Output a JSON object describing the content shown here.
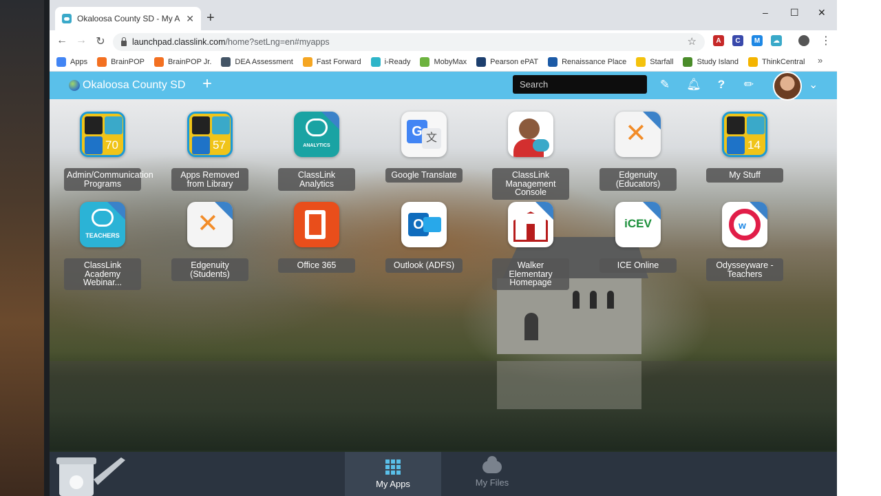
{
  "browser": {
    "tab_title": "Okaloosa County SD - My Apps",
    "new_tab": "+",
    "url_host": "launchpad.classlink.com",
    "url_path": "/home?setLng=en#myapps",
    "window_controls": {
      "minimize": "–",
      "maximize": "☐",
      "close": "✕"
    },
    "bookmarks": [
      {
        "label": "Apps",
        "color": "#4285f4"
      },
      {
        "label": "BrainPOP",
        "color": "#f37021"
      },
      {
        "label": "BrainPOP Jr.",
        "color": "#f37021"
      },
      {
        "label": "DEA Assessment",
        "color": "#445566"
      },
      {
        "label": "Fast Forward",
        "color": "#f5a623"
      },
      {
        "label": "i-Ready",
        "color": "#2eb5c9"
      },
      {
        "label": "MobyMax",
        "color": "#6db33f"
      },
      {
        "label": "Pearson ePAT",
        "color": "#1d3f6e"
      },
      {
        "label": "Renaissance Place",
        "color": "#1c5aa6"
      },
      {
        "label": "Starfall",
        "color": "#f4c20d"
      },
      {
        "label": "Study Island",
        "color": "#4a8c2a"
      },
      {
        "label": "ThinkCentral",
        "color": "#f4b400"
      }
    ],
    "bookmarks_more": "»",
    "extensions": [
      {
        "letter": "A",
        "color": "#c62828"
      },
      {
        "letter": "C",
        "color": "#3949ab"
      },
      {
        "letter": "M",
        "color": "#1e88e5"
      },
      {
        "letter": "☁",
        "color": "#3aa9c9"
      }
    ]
  },
  "header": {
    "org_name": "Okaloosa County SD",
    "add": "+",
    "search_placeholder": "Search",
    "accent": "#5ac0ea"
  },
  "apps": [
    {
      "label": "Admin/Communication Programs",
      "icon": "folder-icon",
      "badge": "70"
    },
    {
      "label": "Apps Removed from Library",
      "icon": "folder-icon",
      "badge": "57"
    },
    {
      "label": "ClassLink Analytics",
      "icon": "classlink-analytics-icon",
      "sub": "ANALYTICS"
    },
    {
      "label": "Google Translate",
      "icon": "google-translate-icon"
    },
    {
      "label": "ClassLink Management Console",
      "icon": "management-console-icon"
    },
    {
      "label": "Edgenuity (Educators)",
      "icon": "edgenuity-icon"
    },
    {
      "label": "My Stuff",
      "icon": "folder-icon",
      "badge": "14"
    },
    {
      "label": "ClassLink Academy Webinar...",
      "icon": "classlink-teachers-icon",
      "sub": "TEACHERS"
    },
    {
      "label": "Edgenuity (Students)",
      "icon": "edgenuity-icon"
    },
    {
      "label": "Office 365",
      "icon": "office-365-icon"
    },
    {
      "label": "Outlook (ADFS)",
      "icon": "outlook-icon"
    },
    {
      "label": "Walker Elementary Homepage",
      "icon": "school-icon"
    },
    {
      "label": "ICE Online",
      "icon": "icev-icon",
      "sub": "iCEV"
    },
    {
      "label": "Odysseyware - Teachers",
      "icon": "odysseyware-icon"
    }
  ],
  "bottom_nav": {
    "my_apps": "My Apps",
    "my_files": "My Files"
  }
}
